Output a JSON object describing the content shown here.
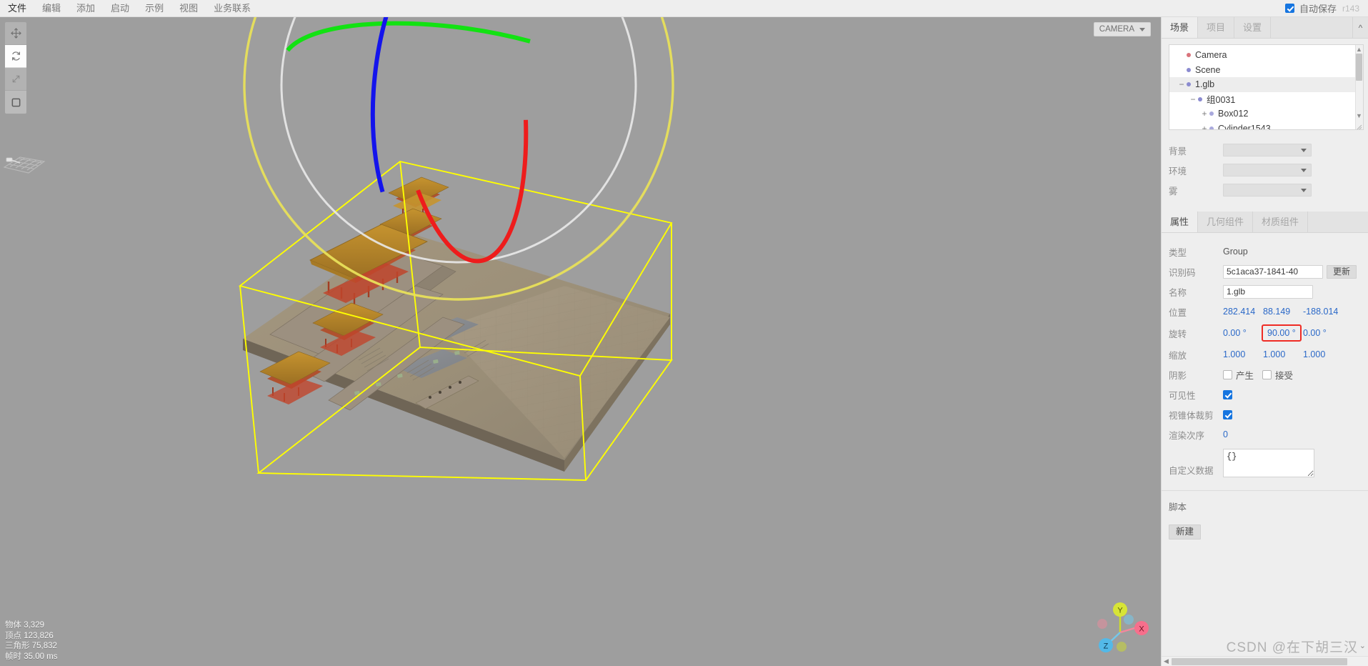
{
  "menubar": {
    "items": [
      {
        "label": "文件",
        "name": "menu-file"
      },
      {
        "label": "编辑",
        "name": "menu-edit"
      },
      {
        "label": "添加",
        "name": "menu-add"
      },
      {
        "label": "启动",
        "name": "menu-play"
      },
      {
        "label": "示例",
        "name": "menu-examples"
      },
      {
        "label": "视图",
        "name": "menu-view"
      },
      {
        "label": "业务联系",
        "name": "menu-contact"
      }
    ],
    "autosave_label": "自动保存",
    "autosave_checked": true,
    "version": "r143"
  },
  "viewport": {
    "camera_select": "CAMERA",
    "tools": [
      {
        "name": "translate-tool",
        "icon": "move-icon",
        "active": false
      },
      {
        "name": "rotate-tool",
        "icon": "rotate-icon",
        "active": true
      },
      {
        "name": "scale-tool",
        "icon": "scale-icon",
        "active": false
      },
      {
        "name": "bounds-tool",
        "icon": "square-icon",
        "active": false
      }
    ],
    "stats": [
      {
        "label": "物体",
        "value": "3,329"
      },
      {
        "label": "顶点",
        "value": "123,826"
      },
      {
        "label": "三角形",
        "value": "75,832"
      },
      {
        "label": "帧时",
        "value": "35.00 ms"
      }
    ],
    "axis_gizmo": {
      "x": "X",
      "y": "Y",
      "z": "Z"
    },
    "selection_color": "#ffff00"
  },
  "sidebar": {
    "tabs": [
      {
        "label": "场景",
        "name": "tab-scene",
        "active": true
      },
      {
        "label": "项目",
        "name": "tab-project",
        "active": false
      },
      {
        "label": "设置",
        "name": "tab-settings",
        "active": false
      }
    ],
    "outliner": [
      {
        "label": "Camera",
        "indent": 0,
        "toggle": "",
        "dot": "#d9737b",
        "selected": false
      },
      {
        "label": "Scene",
        "indent": 0,
        "toggle": "",
        "dot": "#8b8bd0",
        "selected": false
      },
      {
        "label": "1.glb",
        "indent": 0,
        "toggle": "−",
        "dot": "#8b8bd0",
        "selected": true
      },
      {
        "label": "组0031",
        "indent": 1,
        "toggle": "−",
        "dot": "#8b8bd0",
        "selected": false
      },
      {
        "label": "Box012",
        "indent": 2,
        "toggle": "+",
        "dot": "#a9a9dd",
        "selected": false
      },
      {
        "label": "Cylinder1543",
        "indent": 2,
        "toggle": "+",
        "dot": "#a9a9dd",
        "selected": false
      }
    ],
    "scene_props": [
      {
        "label": "背景",
        "name": "background-select",
        "value": ""
      },
      {
        "label": "环境",
        "name": "environment-select",
        "value": ""
      },
      {
        "label": "雾",
        "name": "fog-select",
        "value": ""
      }
    ],
    "object_tabs": [
      {
        "label": "属性",
        "name": "tab-object",
        "active": true
      },
      {
        "label": "几何组件",
        "name": "tab-geometry",
        "active": false
      },
      {
        "label": "材质组件",
        "name": "tab-material",
        "active": false
      }
    ],
    "object": {
      "type_label": "类型",
      "type_value": "Group",
      "uuid_label": "识别码",
      "uuid_value": "5c1aca37-1841-40",
      "uuid_button": "更新",
      "name_label": "名称",
      "name_value": "1.glb",
      "position_label": "位置",
      "position": [
        "282.414",
        "88.149",
        "-188.014"
      ],
      "rotation_label": "旋转",
      "rotation": [
        "0.00 °",
        "90.00 °",
        "0.00 °"
      ],
      "rotation_highlight_index": 1,
      "scale_label": "缩放",
      "scale": [
        "1.000",
        "1.000",
        "1.000"
      ],
      "shadow_label": "阴影",
      "shadow_cast_label": "产生",
      "shadow_cast_checked": false,
      "shadow_receive_label": "接受",
      "shadow_receive_checked": false,
      "visible_label": "可见性",
      "visible_checked": true,
      "frustum_label": "视锥体裁剪",
      "frustum_checked": true,
      "render_order_label": "渲染次序",
      "render_order_value": "0",
      "userdata_label": "自定义数据",
      "userdata_value": "{}"
    },
    "script": {
      "title": "脚本",
      "new_button": "新建"
    }
  },
  "watermark": "CSDN @在下胡三汉"
}
